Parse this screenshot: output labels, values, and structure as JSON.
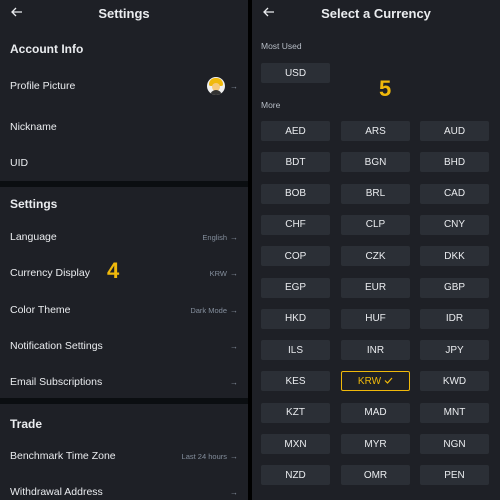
{
  "settings_screen": {
    "title": "Settings",
    "sections": [
      {
        "heading": "Account Info",
        "rows": [
          {
            "label": "Profile Picture",
            "value": "",
            "chevron": "→"
          },
          {
            "label": "Nickname",
            "value": "",
            "chevron": ""
          },
          {
            "label": "UID",
            "value": "",
            "chevron": ""
          }
        ]
      },
      {
        "heading": "Settings",
        "rows": [
          {
            "label": "Language",
            "value": "English",
            "chevron": "→"
          },
          {
            "label": "Currency Display",
            "value": "KRW",
            "chevron": "→"
          },
          {
            "label": "Color Theme",
            "value": "Dark Mode",
            "chevron": "→"
          },
          {
            "label": "Notification Settings",
            "value": "",
            "chevron": "→"
          },
          {
            "label": "Email Subscriptions",
            "value": "",
            "chevron": "→"
          }
        ]
      },
      {
        "heading": "Trade",
        "rows": [
          {
            "label": "Benchmark Time Zone",
            "value": "Last 24 hours",
            "chevron": "→"
          },
          {
            "label": "Withdrawal Address",
            "value": "",
            "chevron": "→"
          }
        ]
      }
    ],
    "step_marker": "4"
  },
  "currency_screen": {
    "title": "Select a Currency",
    "most_used_label": "Most Used",
    "most_used": [
      "USD"
    ],
    "more_label": "More",
    "currencies": [
      "AED",
      "ARS",
      "AUD",
      "BDT",
      "BGN",
      "BHD",
      "BOB",
      "BRL",
      "CAD",
      "CHF",
      "CLP",
      "CNY",
      "COP",
      "CZK",
      "DKK",
      "EGP",
      "EUR",
      "GBP",
      "HKD",
      "HUF",
      "IDR",
      "ILS",
      "INR",
      "JPY",
      "KES",
      "KRW",
      "KWD",
      "KZT",
      "MAD",
      "MNT",
      "MXN",
      "MYR",
      "NGN",
      "NZD",
      "OMR",
      "PEN"
    ],
    "selected": "KRW",
    "step_marker": "5"
  },
  "icons": {
    "back": "arrow-left-icon",
    "chevron": "arrow-right-icon",
    "check": "check-icon"
  },
  "colors": {
    "accent": "#F0B90B",
    "panel_bg": "#1E2026",
    "button_bg": "#2B2F36",
    "muted_text": "#848E9C"
  }
}
